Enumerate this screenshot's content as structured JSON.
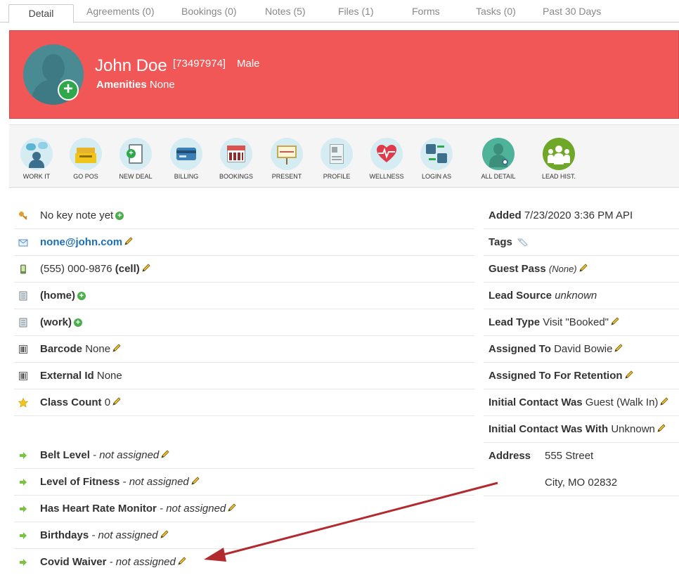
{
  "tabs": [
    {
      "label": "Detail"
    },
    {
      "label": "Agreements (0)"
    },
    {
      "label": "Bookings (0)"
    },
    {
      "label": "Notes (5)"
    },
    {
      "label": "Files (1)"
    },
    {
      "label": "Forms"
    },
    {
      "label": "Tasks (0)"
    },
    {
      "label": "Past 30 Days"
    }
  ],
  "header": {
    "name": "John Doe",
    "member_id": "[73497974]",
    "gender": "Male",
    "amenities_label": "Amenities",
    "amenities_value": "None",
    "background_color": "#f25757"
  },
  "toolbar": [
    {
      "label": "WORK IT",
      "icon": "chat-people-icon"
    },
    {
      "label": "GO POS",
      "icon": "cash-register-icon"
    },
    {
      "label": "NEW DEAL",
      "icon": "clipboard-plus-icon"
    },
    {
      "label": "BILLING",
      "icon": "credit-card-icon"
    },
    {
      "label": "BOOKINGS",
      "icon": "calendar-icon"
    },
    {
      "label": "PRESENT",
      "icon": "presentation-board-icon"
    },
    {
      "label": "PROFILE",
      "icon": "profile-document-icon"
    },
    {
      "label": "WELLNESS",
      "icon": "heart-pulse-icon"
    },
    {
      "label": "LOGIN AS",
      "icon": "switch-user-icon"
    },
    {
      "label": "ALL DETAIL",
      "icon": "user-detail-icon"
    },
    {
      "label": "LEAD HIST.",
      "icon": "group-people-icon"
    }
  ],
  "left": {
    "key_note": "No key note yet",
    "email": "none@john.com",
    "phone": "(555) 000-9876",
    "phone_type": "(cell)",
    "home_label": "(home)",
    "work_label": "(work)",
    "barcode_label": "Barcode",
    "barcode_value": "None",
    "external_id_label": "External Id",
    "external_id_value": "None",
    "class_count_label": "Class Count",
    "class_count_value": "0",
    "custom_fields": [
      {
        "label": "Belt Level",
        "value": "- not assigned"
      },
      {
        "label": "Level of Fitness",
        "value": "- not assigned"
      },
      {
        "label": "Has Heart Rate Monitor",
        "value": "- not assigned"
      },
      {
        "label": "Birthdays",
        "value": "- not assigned"
      },
      {
        "label": "Covid Waiver",
        "value": "- not assigned"
      }
    ]
  },
  "right": {
    "added_label": "Added",
    "added_value": "7/23/2020 3:36 PM API",
    "tags_label": "Tags",
    "guest_pass_label": "Guest Pass",
    "guest_pass_value": "(None)",
    "lead_source_label": "Lead Source",
    "lead_source_value": "unknown",
    "lead_type_label": "Lead Type",
    "lead_type_value": "Visit \"Booked\"",
    "assigned_to_label": "Assigned To",
    "assigned_to_value": "David Bowie",
    "retention_label": "Assigned To For Retention",
    "initial_contact_label": "Initial Contact Was",
    "initial_contact_value": "Guest (Walk In)",
    "initial_with_label": "Initial Contact Was With",
    "initial_with_value": "Unknown",
    "address_label": "Address",
    "address_line1": "555 Street",
    "address_line2": "City, MO 02832"
  }
}
